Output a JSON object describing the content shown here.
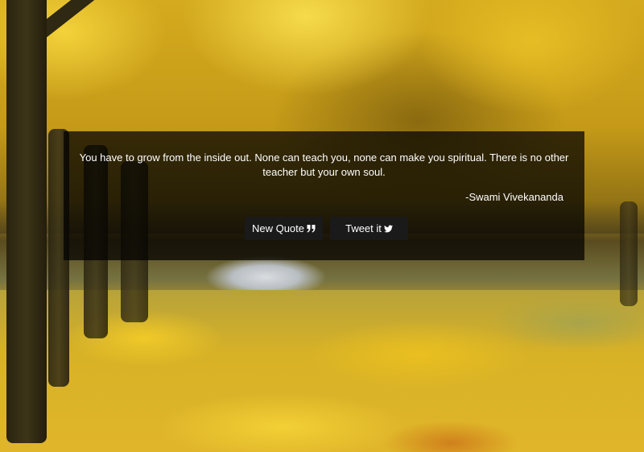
{
  "quote": {
    "text": "You have to grow from the inside out. None can teach you, none can make you spiritual. There is no other teacher but your own soul.",
    "author": "-Swami Vivekananda"
  },
  "buttons": {
    "new_quote": {
      "label": "New Quote",
      "icon": "quote-right-icon"
    },
    "tweet": {
      "label": "Tweet it",
      "icon": "twitter-icon"
    }
  },
  "colors": {
    "panel_background": "#000000",
    "button_background": "#1a1a1a",
    "text": "#ffffff"
  }
}
